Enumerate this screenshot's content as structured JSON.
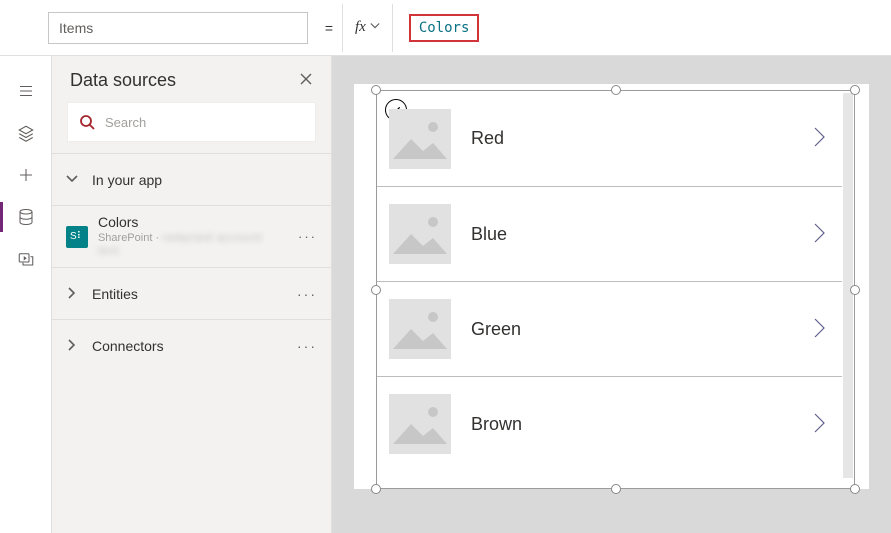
{
  "topbar": {
    "property_name": "Items",
    "fx_label": "fx",
    "equals": "=",
    "formula_value": "Colors"
  },
  "panel": {
    "title": "Data sources",
    "search_placeholder": "Search",
    "sections": {
      "in_app": "In your app",
      "entities": "Entities",
      "connectors": "Connectors"
    },
    "datasource": {
      "icon_text": "S⠇",
      "name": "Colors",
      "subtype": "SharePoint"
    }
  },
  "gallery": {
    "items": [
      {
        "title": "Red"
      },
      {
        "title": "Blue"
      },
      {
        "title": "Green"
      },
      {
        "title": "Brown"
      }
    ]
  }
}
